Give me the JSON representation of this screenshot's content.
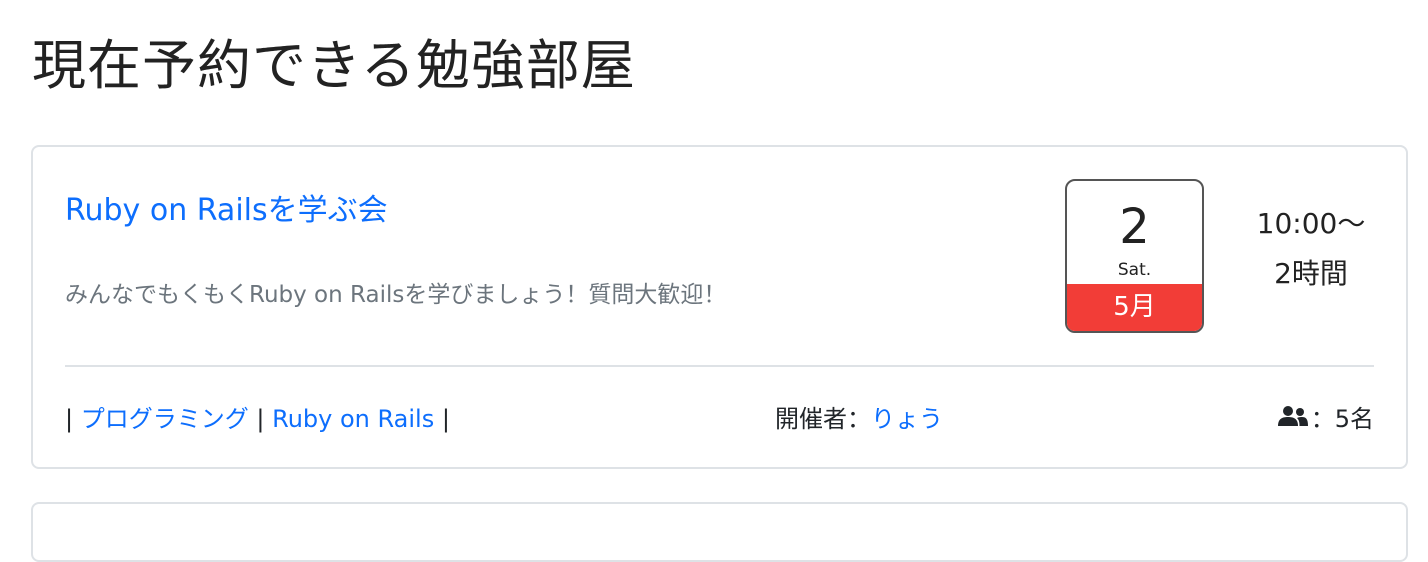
{
  "page": {
    "title": "現在予約できる勉強部屋"
  },
  "events": [
    {
      "title": "Ruby on Railsを学ぶ会",
      "description": "みんなでもくもくRuby on Railsを学びましょう！質問大歓迎！",
      "calendar": {
        "day": "2",
        "weekday": "Sat.",
        "month": "5月"
      },
      "time": {
        "start": "10:00〜",
        "duration": "2時間"
      },
      "tags": [
        "プログラミング",
        "Ruby on Rails"
      ],
      "tag_separator": "|",
      "organizer_label": "開催者：",
      "organizer_name": "りょう",
      "capacity_text": "：5名"
    }
  ],
  "colors": {
    "link": "#0d6efd",
    "month_banner": "#f23d37",
    "muted_text": "#6c757d",
    "border": "#dee2e6"
  },
  "icons": {
    "capacity": "users-icon"
  }
}
